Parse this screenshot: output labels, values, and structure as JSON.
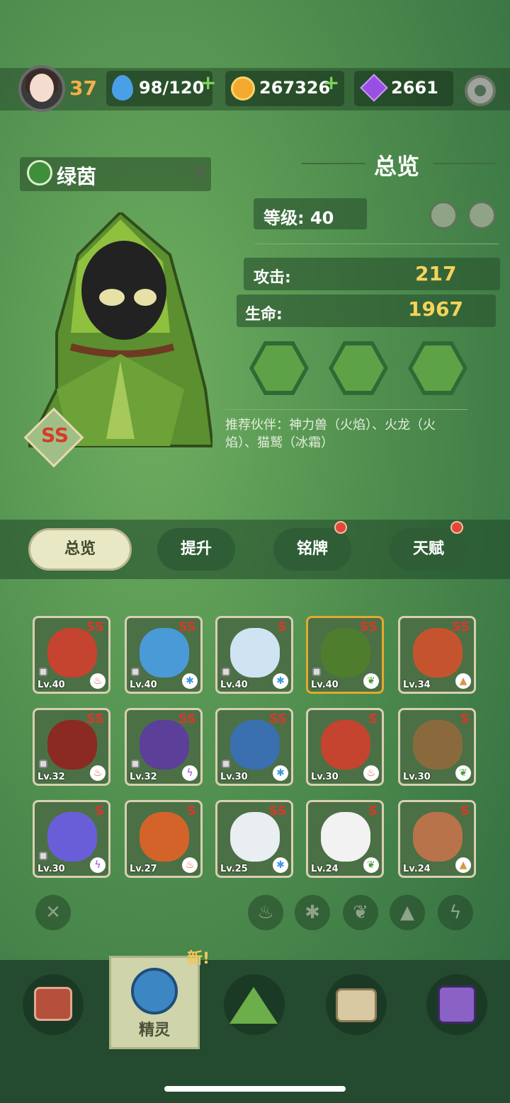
{
  "topbar": {
    "player_level": "37",
    "energy": "98/120",
    "energy_plus": "+",
    "coins": "267326",
    "coins_plus": "+",
    "gems": "2661"
  },
  "hero": {
    "name": "绿茵",
    "rank": "SS"
  },
  "overview": {
    "title": "总览",
    "level_label": "等级:",
    "level_value": "40",
    "attack_label": "攻击:",
    "attack_value": "217",
    "hp_label": "生命:",
    "hp_value": "1967",
    "partners": "推荐伙伴：神力兽（火焰）、火龙（火焰）、猫鹫（冰霜）"
  },
  "tabs": [
    {
      "label": "总览"
    },
    {
      "label": "提升"
    },
    {
      "label": "铭牌"
    },
    {
      "label": "天赋"
    }
  ],
  "cards": [
    {
      "rank": "SS",
      "level": "Lv.40",
      "element": "fire",
      "color": "#c4442f"
    },
    {
      "rank": "SS",
      "level": "Lv.40",
      "element": "ice",
      "color": "#4a9ad8"
    },
    {
      "rank": "S",
      "level": "Lv.40",
      "element": "ice",
      "color": "#cfe3f2"
    },
    {
      "rank": "SS",
      "level": "Lv.40",
      "element": "leaf",
      "color": "#4f7d2e"
    },
    {
      "rank": "SS",
      "level": "Lv.34",
      "element": "earth",
      "color": "#c5542e"
    },
    {
      "rank": "SS",
      "level": "Lv.32",
      "element": "fire",
      "color": "#8b2a22"
    },
    {
      "rank": "SS",
      "level": "Lv.32",
      "element": "bolt",
      "color": "#5b3f98"
    },
    {
      "rank": "SS",
      "level": "Lv.30",
      "element": "ice",
      "color": "#3a6fb0"
    },
    {
      "rank": "S",
      "level": "Lv.30",
      "element": "fire",
      "color": "#c4442f"
    },
    {
      "rank": "S",
      "level": "Lv.30",
      "element": "leaf",
      "color": "#8a6a3c"
    },
    {
      "rank": "S",
      "level": "Lv.30",
      "element": "bolt",
      "color": "#6a5ed8"
    },
    {
      "rank": "S",
      "level": "Lv.27",
      "element": "fire",
      "color": "#d4632a"
    },
    {
      "rank": "SS",
      "level": "Lv.25",
      "element": "ice",
      "color": "#e8eef2"
    },
    {
      "rank": "S",
      "level": "Lv.24",
      "element": "leaf",
      "color": "#f2f2f2"
    },
    {
      "rank": "S",
      "level": "Lv.24",
      "element": "earth",
      "color": "#b8734a"
    }
  ],
  "bottom_nav": {
    "sprite_label": "精灵",
    "new_badge": "新!"
  },
  "colors": {
    "accent_gold": "#f6d35a",
    "rank_red": "#d6392a",
    "plus_green": "#7bd658"
  }
}
